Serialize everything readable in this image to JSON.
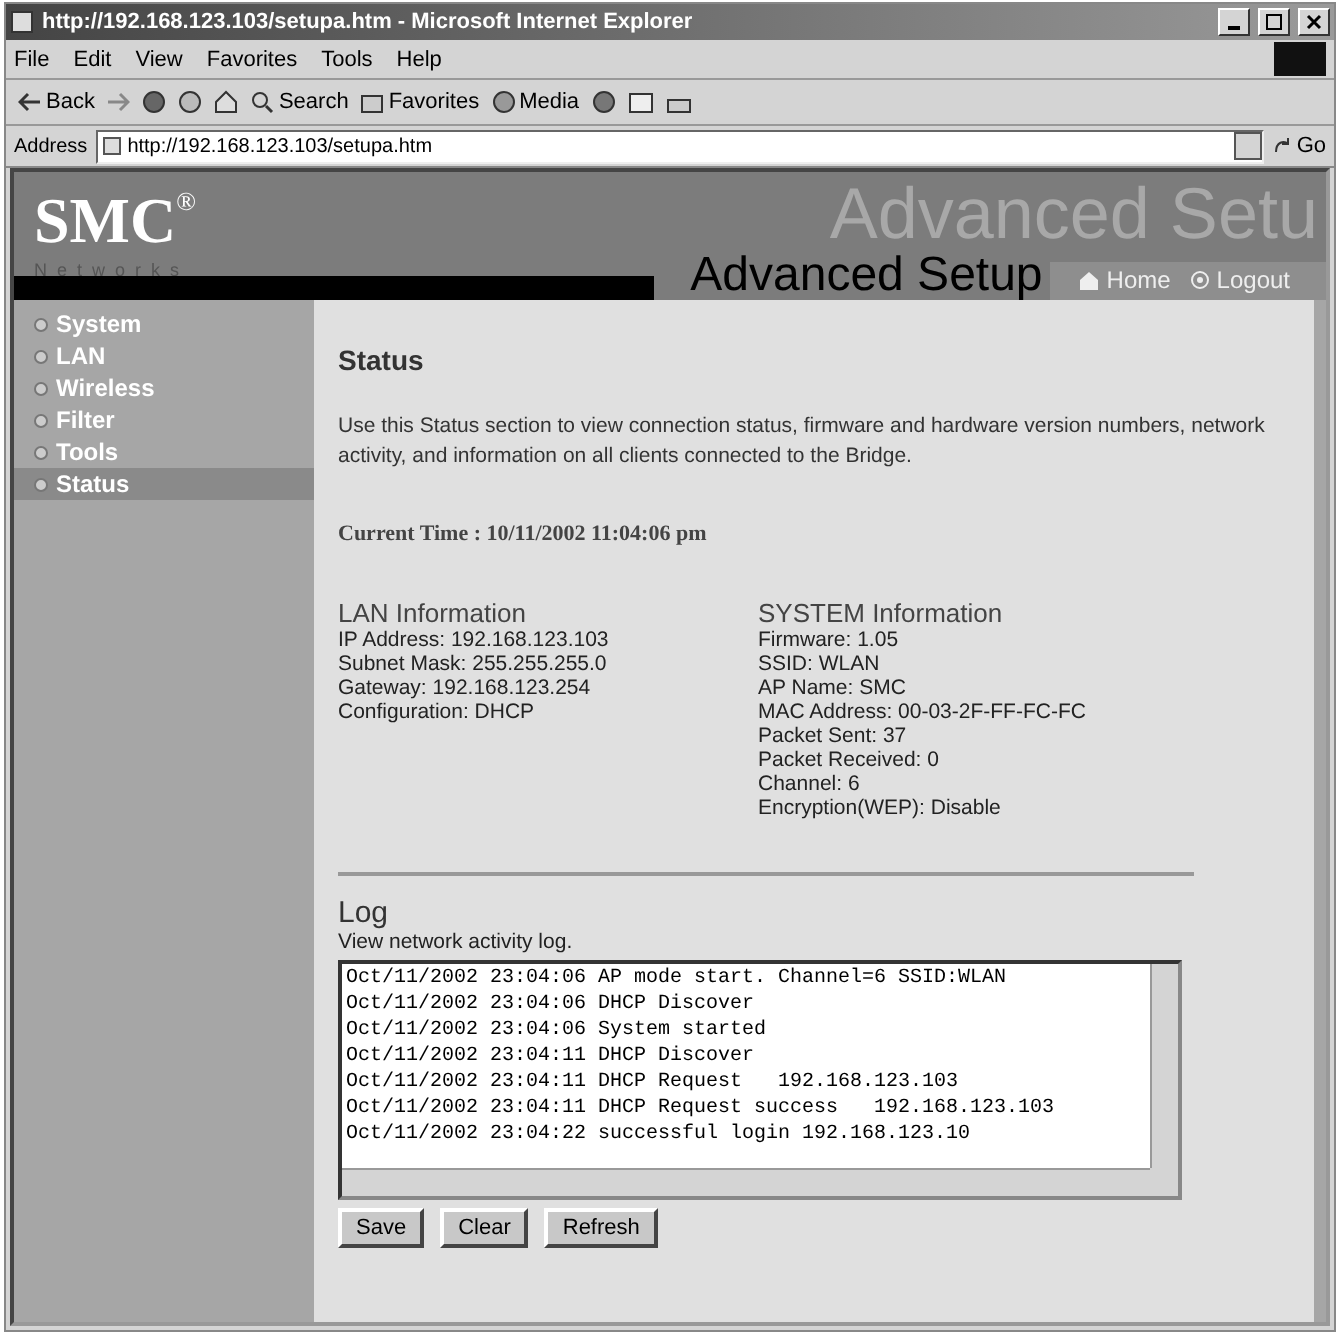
{
  "window": {
    "title": "http://192.168.123.103/setupa.htm - Microsoft Internet Explorer"
  },
  "menu": [
    "File",
    "Edit",
    "View",
    "Favorites",
    "Tools",
    "Help"
  ],
  "toolbar": [
    {
      "kind": "back",
      "label": "Back"
    },
    {
      "kind": "forward"
    },
    {
      "kind": "stop"
    },
    {
      "kind": "refresh"
    },
    {
      "kind": "home"
    },
    {
      "kind": "search",
      "label": "Search"
    },
    {
      "kind": "favorites",
      "label": "Favorites"
    },
    {
      "kind": "media",
      "label": "Media"
    },
    {
      "kind": "history"
    },
    {
      "kind": "mail"
    },
    {
      "kind": "print"
    }
  ],
  "address": {
    "label": "Address",
    "value": "http://192.168.123.103/setupa.htm",
    "go": "Go"
  },
  "banner": {
    "logo": "SMC$^{®}$",
    "tagline": "Networks",
    "watermark": "Advanced Setu",
    "title": "Advanced Setup",
    "links": [
      {
        "kind": "home",
        "label": "Home"
      },
      {
        "kind": "logout",
        "label": "Logout"
      }
    ]
  },
  "sidebar": {
    "items": [
      {
        "label": "System",
        "selected": false
      },
      {
        "label": "LAN",
        "selected": false
      },
      {
        "label": "Wireless",
        "selected": false
      },
      {
        "label": "Filter",
        "selected": false
      },
      {
        "label": "Tools",
        "selected": false
      },
      {
        "label": "Status",
        "selected": true
      }
    ]
  },
  "status": {
    "heading": "Status",
    "description": "Use this Status section to view connection status, firmware and hardware version numbers, network activity, and information on all clients connected to the Bridge.",
    "current_time_label": "Current Time :",
    "current_time": "10/11/2002 11:04:06 pm"
  },
  "lan": {
    "heading": "LAN Information",
    "rows": [
      {
        "label": "IP Address:",
        "value": "192.168.123.103"
      },
      {
        "label": "Subnet Mask:",
        "value": "255.255.255.0"
      },
      {
        "label": "Gateway:",
        "value": "192.168.123.254"
      },
      {
        "label": "Configuration:",
        "value": "DHCP"
      }
    ]
  },
  "system": {
    "heading": "SYSTEM Information",
    "rows": [
      {
        "label": "Firmware:",
        "value": "1.05"
      },
      {
        "label": "SSID:",
        "value": "WLAN"
      },
      {
        "label": "AP Name:",
        "value": "SMC"
      },
      {
        "label": "MAC Address:",
        "value": "00-03-2F-FF-FC-FC"
      },
      {
        "label": "Packet Sent:",
        "value": "37"
      },
      {
        "label": "Packet Received:",
        "value": "0"
      },
      {
        "label": "Channel:",
        "value": "6"
      },
      {
        "label": "Encryption(WEP):",
        "value": "Disable"
      }
    ]
  },
  "log": {
    "heading": "Log",
    "subtitle": "View network activity log.",
    "lines": [
      "Oct/11/2002 23:04:06 AP mode start. Channel=6 SSID:WLAN",
      "Oct/11/2002 23:04:06 DHCP Discover",
      "Oct/11/2002 23:04:06 System started",
      "Oct/11/2002 23:04:11 DHCP Discover",
      "Oct/11/2002 23:04:11 DHCP Request   192.168.123.103",
      "Oct/11/2002 23:04:11 DHCP Request success   192.168.123.103",
      "Oct/11/2002 23:04:22 successful login 192.168.123.10"
    ],
    "buttons": [
      "Save",
      "Clear",
      "Refresh"
    ]
  }
}
